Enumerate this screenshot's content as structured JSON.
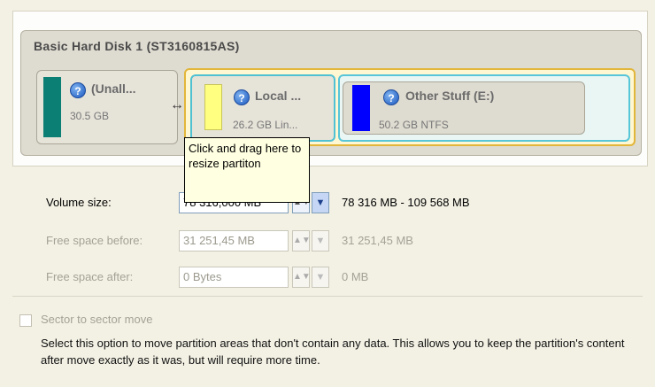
{
  "disk": {
    "title": "Basic Hard Disk 1 (ST3160815AS)",
    "partitions": [
      {
        "name": "(Unall...",
        "info": "30.5 GB",
        "color": "#0b7f73",
        "icon": "help-icon"
      },
      {
        "name": "Local ...",
        "info": "26.2 GB Lin...",
        "color": "#ffff80",
        "icon": "help-icon"
      },
      {
        "name": "Other Stuff (E:)",
        "info": "50.2 GB NTFS",
        "color": "#0000ff",
        "icon": "help-icon"
      }
    ],
    "resize_handle": "↔",
    "tooltip": "Click and drag here to resize partiton"
  },
  "form": {
    "volume_size": {
      "label": "Volume size:",
      "value": "78 316,000 MB",
      "range": "78 316 MB - 109 568 MB"
    },
    "free_before": {
      "label": "Free space before:",
      "value": "31 251,45 MB",
      "range": "31 251,45 MB"
    },
    "free_after": {
      "label": "Free space after:",
      "value": "0 Bytes",
      "range": "0 MB"
    }
  },
  "sector_move": {
    "label": "Sector to sector move",
    "description": "Select this option to move partition areas that don't contain any data. This allows you to keep the partition's content after move exactly as it was, but will require more time."
  }
}
